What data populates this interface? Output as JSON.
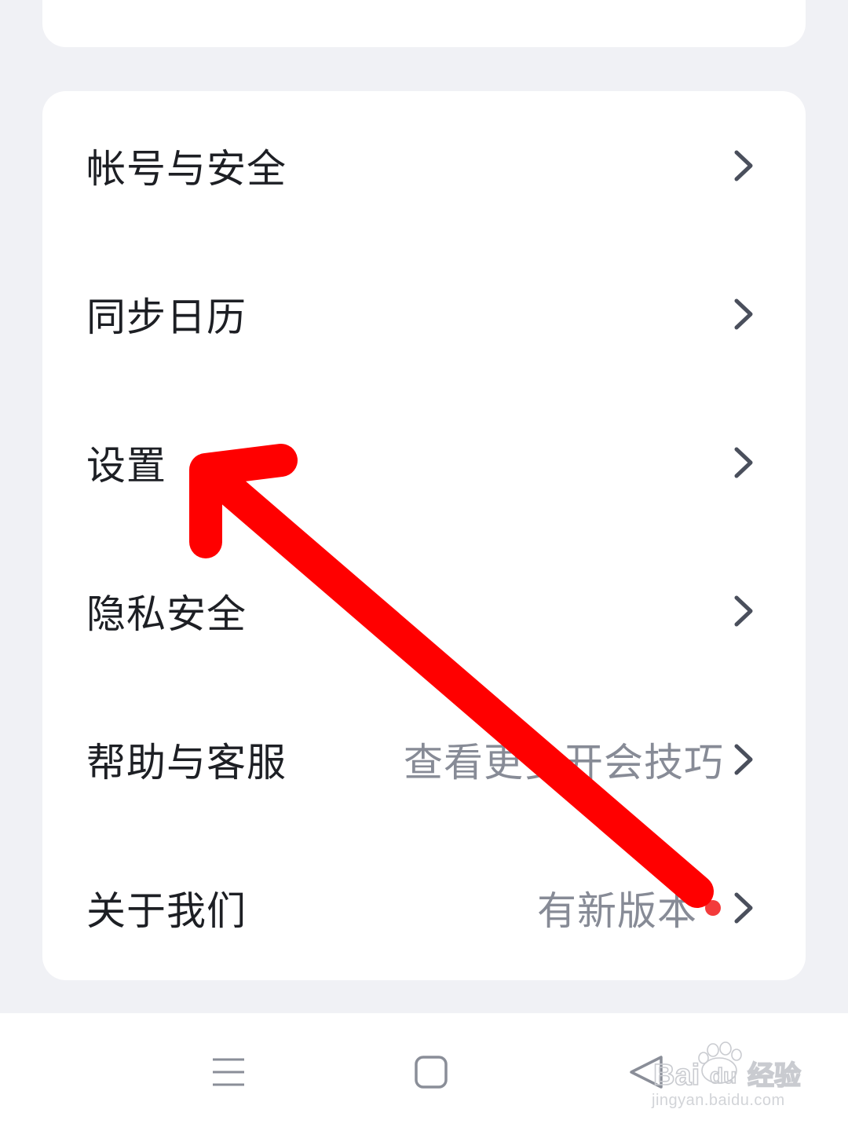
{
  "settings_list": {
    "items": [
      {
        "label": "帐号与安全",
        "sub": "",
        "badge": false
      },
      {
        "label": "同步日历",
        "sub": "",
        "badge": false
      },
      {
        "label": "设置",
        "sub": "",
        "badge": false
      },
      {
        "label": "隐私安全",
        "sub": "",
        "badge": false
      },
      {
        "label": "帮助与客服",
        "sub": "查看更多开会技巧",
        "badge": false
      },
      {
        "label": "关于我们",
        "sub": "有新版本",
        "badge": true
      }
    ]
  },
  "icons": {
    "chevron": "chevron-right-icon",
    "menu": "menu-icon",
    "home": "home-square-icon",
    "back": "back-triangle-icon"
  },
  "watermark": {
    "brand": "Bai",
    "brand_suffix": "经验",
    "url": "jingyan.baidu.com"
  },
  "colors": {
    "background": "#f0f1f5",
    "card": "#ffffff",
    "text": "#1d1f24",
    "subtext": "#878b96",
    "chevron": "#4a4f5c",
    "badge": "#f33b3b",
    "annotation_arrow": "#ff0000"
  }
}
